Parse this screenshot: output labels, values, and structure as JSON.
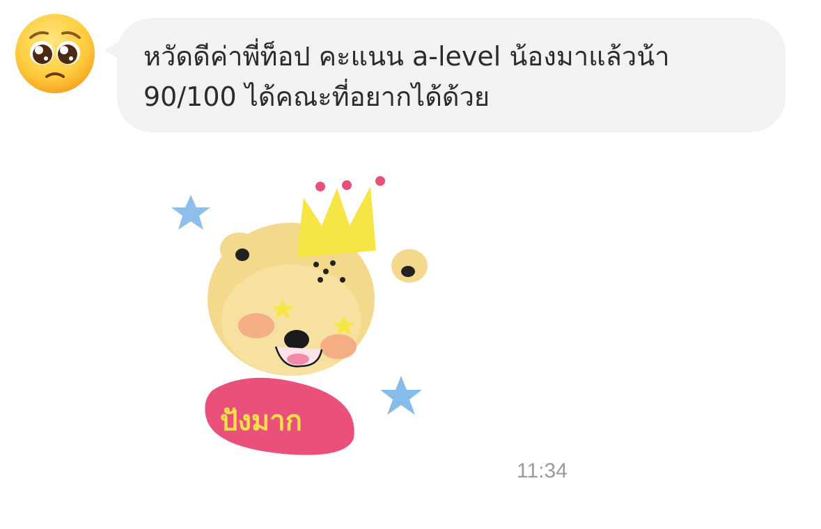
{
  "message": {
    "sender_avatar_icon": "pleading-face-emoji-icon",
    "text": "หวัดดีค่าพี่ท็อป คะแนน a-level น้องมาแล้วน้า\n90/100 ได้คณะที่อยากได้ด้วย"
  },
  "sticker": {
    "icon": "cheetah-with-crown-sticker-icon",
    "label": "ปังมาก",
    "colors": {
      "label_bg": "#e9517a",
      "label_text": "#f6e04a",
      "crown": "#f5e646",
      "star": "#7fb8e8",
      "face": "#f4d98c"
    }
  },
  "timestamp": "11:34"
}
